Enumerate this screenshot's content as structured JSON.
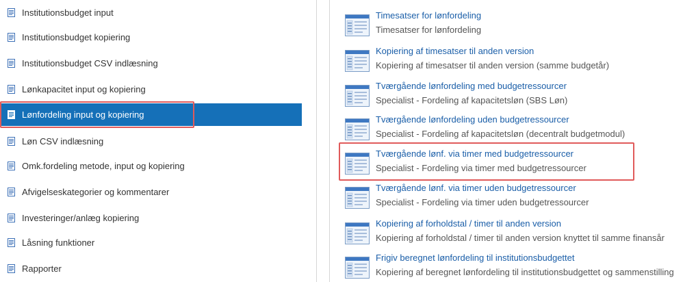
{
  "sidebar": {
    "items": [
      {
        "label": "Institutionsbudget input",
        "icon": "document-icon"
      },
      {
        "label": "Institutionsbudget kopiering",
        "icon": "document-icon"
      },
      {
        "label": "Institutionsbudget CSV indlæsning",
        "icon": "document-icon"
      },
      {
        "label": "Lønkapacitet input og kopiering",
        "icon": "document-icon"
      },
      {
        "label": "Lønfordeling input og kopiering",
        "icon": "document-icon",
        "selected": true
      },
      {
        "label": "Løn CSV indlæsning",
        "icon": "document-icon"
      },
      {
        "label": "Omk.fordeling metode, input og kopiering",
        "icon": "document-icon"
      },
      {
        "label": "Afvigelseskategorier og kommentarer",
        "icon": "document-icon"
      },
      {
        "label": "Investeringer/anlæg kopiering",
        "icon": "document-icon"
      },
      {
        "label": "Låsning funktioner",
        "icon": "document-icon"
      },
      {
        "label": "Rapporter",
        "icon": "document-icon"
      }
    ]
  },
  "content": {
    "entries": [
      {
        "title": "Timesatser for lønfordeling",
        "description": "Timesatser for lønfordeling",
        "icon": "form-page-icon"
      },
      {
        "title": "Kopiering af timesatser til anden version",
        "description": "Kopiering af timesatser til anden version (samme budgetår)",
        "icon": "form-page-icon"
      },
      {
        "title": "Tværgående lønfordeling med budgetressourcer",
        "description": "Specialist - Fordeling af kapacitetsløn (SBS Løn)",
        "icon": "form-page-icon"
      },
      {
        "title": "Tværgående lønfordeling uden budgetressourcer",
        "description": "Specialist - Fordeling af kapacitetsløn (decentralt budgetmodul)",
        "icon": "form-page-icon"
      },
      {
        "title": "Tværgående lønf. via timer med budgetressourcer",
        "description": "Specialist - Fordeling via timer med budgetressourcer",
        "icon": "form-page-icon",
        "highlighted": true
      },
      {
        "title": "Tværgående lønf. via timer uden budgetressourcer",
        "description": "Specialist - Fordeling via timer uden budgetressourcer",
        "icon": "form-page-icon"
      },
      {
        "title": "Kopiering af forholdstal / timer til anden version",
        "description": "Kopiering af forholdstal / timer til anden version knyttet til samme finansår",
        "icon": "form-page-icon"
      },
      {
        "title": "Frigiv beregnet lønfordeling til institutionsbudgettet",
        "description": "Kopiering af beregnet lønfordeling til institutionsbudgettet og sammenstilling",
        "icon": "form-page-icon"
      }
    ]
  },
  "colors": {
    "selected_bg": "#1570b8",
    "link": "#1a5ea8",
    "highlight_border": "#e05a5a"
  }
}
